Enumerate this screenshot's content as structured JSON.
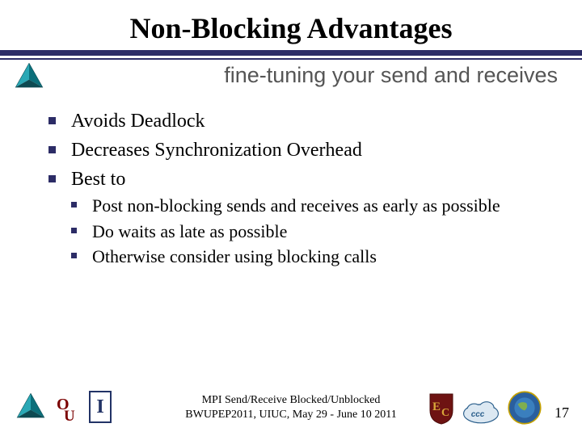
{
  "title": "Non-Blocking Advantages",
  "subtitle": "fine-tuning your send and receives",
  "bullets": {
    "b1": "Avoids Deadlock",
    "b2": "Decreases Synchronization Overhead",
    "b3": "Best to",
    "b3a": "Post non-blocking sends and receives as early as possible",
    "b3b": "Do waits as late as possible",
    "b3c": "Otherwise consider using blocking calls"
  },
  "footer": {
    "line1": "MPI Send/Receive Blocked/Unblocked",
    "line2": "BWUPEP2011, UIUC, May 29 - June 10 2011"
  },
  "page_number": "17",
  "logos": {
    "prism": "prism-icon",
    "ou": "ou-logo",
    "illinois": "illinois-logo",
    "ec_shield": "ec-shield-logo",
    "ccc_cloud": "ccc-cloud-logo",
    "seal": "globe-seal-logo"
  },
  "illinois_letter": "I"
}
